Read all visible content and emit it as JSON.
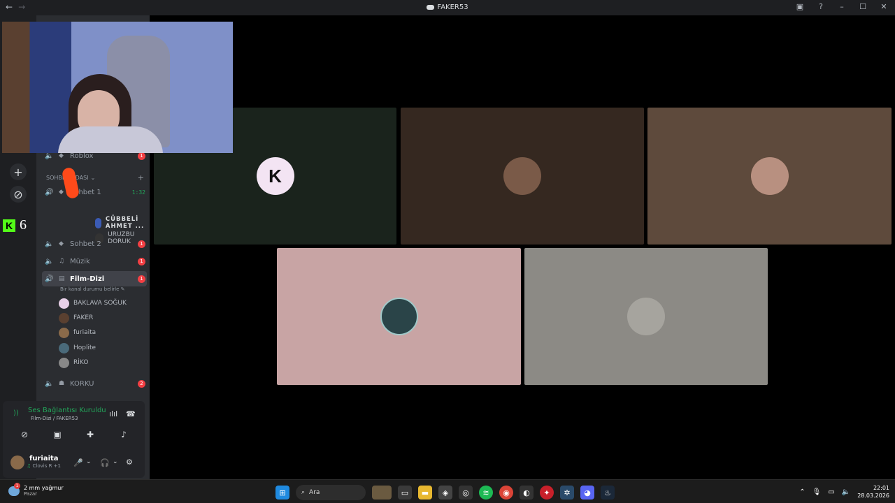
{
  "window": {
    "title": "FAKER53",
    "nav_back": "←",
    "nav_forward": "→"
  },
  "guilds": {
    "add_icon": "+",
    "explore_icon": "⊘",
    "kick_count": "6"
  },
  "channels": {
    "top_channel": {
      "name": "Roblox",
      "badge": "1"
    },
    "category": "SOHBET ODASI",
    "sohbet1": {
      "name": "Sohbet 1",
      "time": "1:32"
    },
    "sohbet1_members": [
      "CÜBBELİ AHMET ...",
      "URUZBU DORUK"
    ],
    "sohbet2": {
      "name": "Sohbet 2",
      "badge": "1"
    },
    "muzik": {
      "name": "Müzik",
      "badge": "1"
    },
    "filmdizi": {
      "name": "Film-Dizi",
      "badge": "1",
      "status": "Bir kanal durumu belirle"
    },
    "filmdizi_members": [
      "BAKLAVA SOĞUK",
      "FAKER",
      "furiaita",
      "Hoplite",
      "RİKO"
    ],
    "korku": {
      "name": "KORKU",
      "badge": "2"
    }
  },
  "voice": {
    "status": "Ses Bağlantısı Kuruldu",
    "location": "Film-Dizi / FAKER53",
    "user_name": "furiaita",
    "user_sub": "Clovis R +1"
  },
  "stage": {
    "tiles": [
      {
        "label": "K",
        "color": "#1a231c"
      },
      {
        "label": "",
        "color": "#352820"
      },
      {
        "label": "",
        "color": "#5e4a3c"
      },
      {
        "label": "",
        "color": "#c8a4a4"
      },
      {
        "label": "",
        "color": "#8c8a85"
      }
    ]
  },
  "taskbar": {
    "weather_temp": "2 mm yağmur",
    "weather_day": "Pazar",
    "weather_badge": "1",
    "search_label": "Ara",
    "time": "22:01",
    "date": "28.03.2026"
  }
}
